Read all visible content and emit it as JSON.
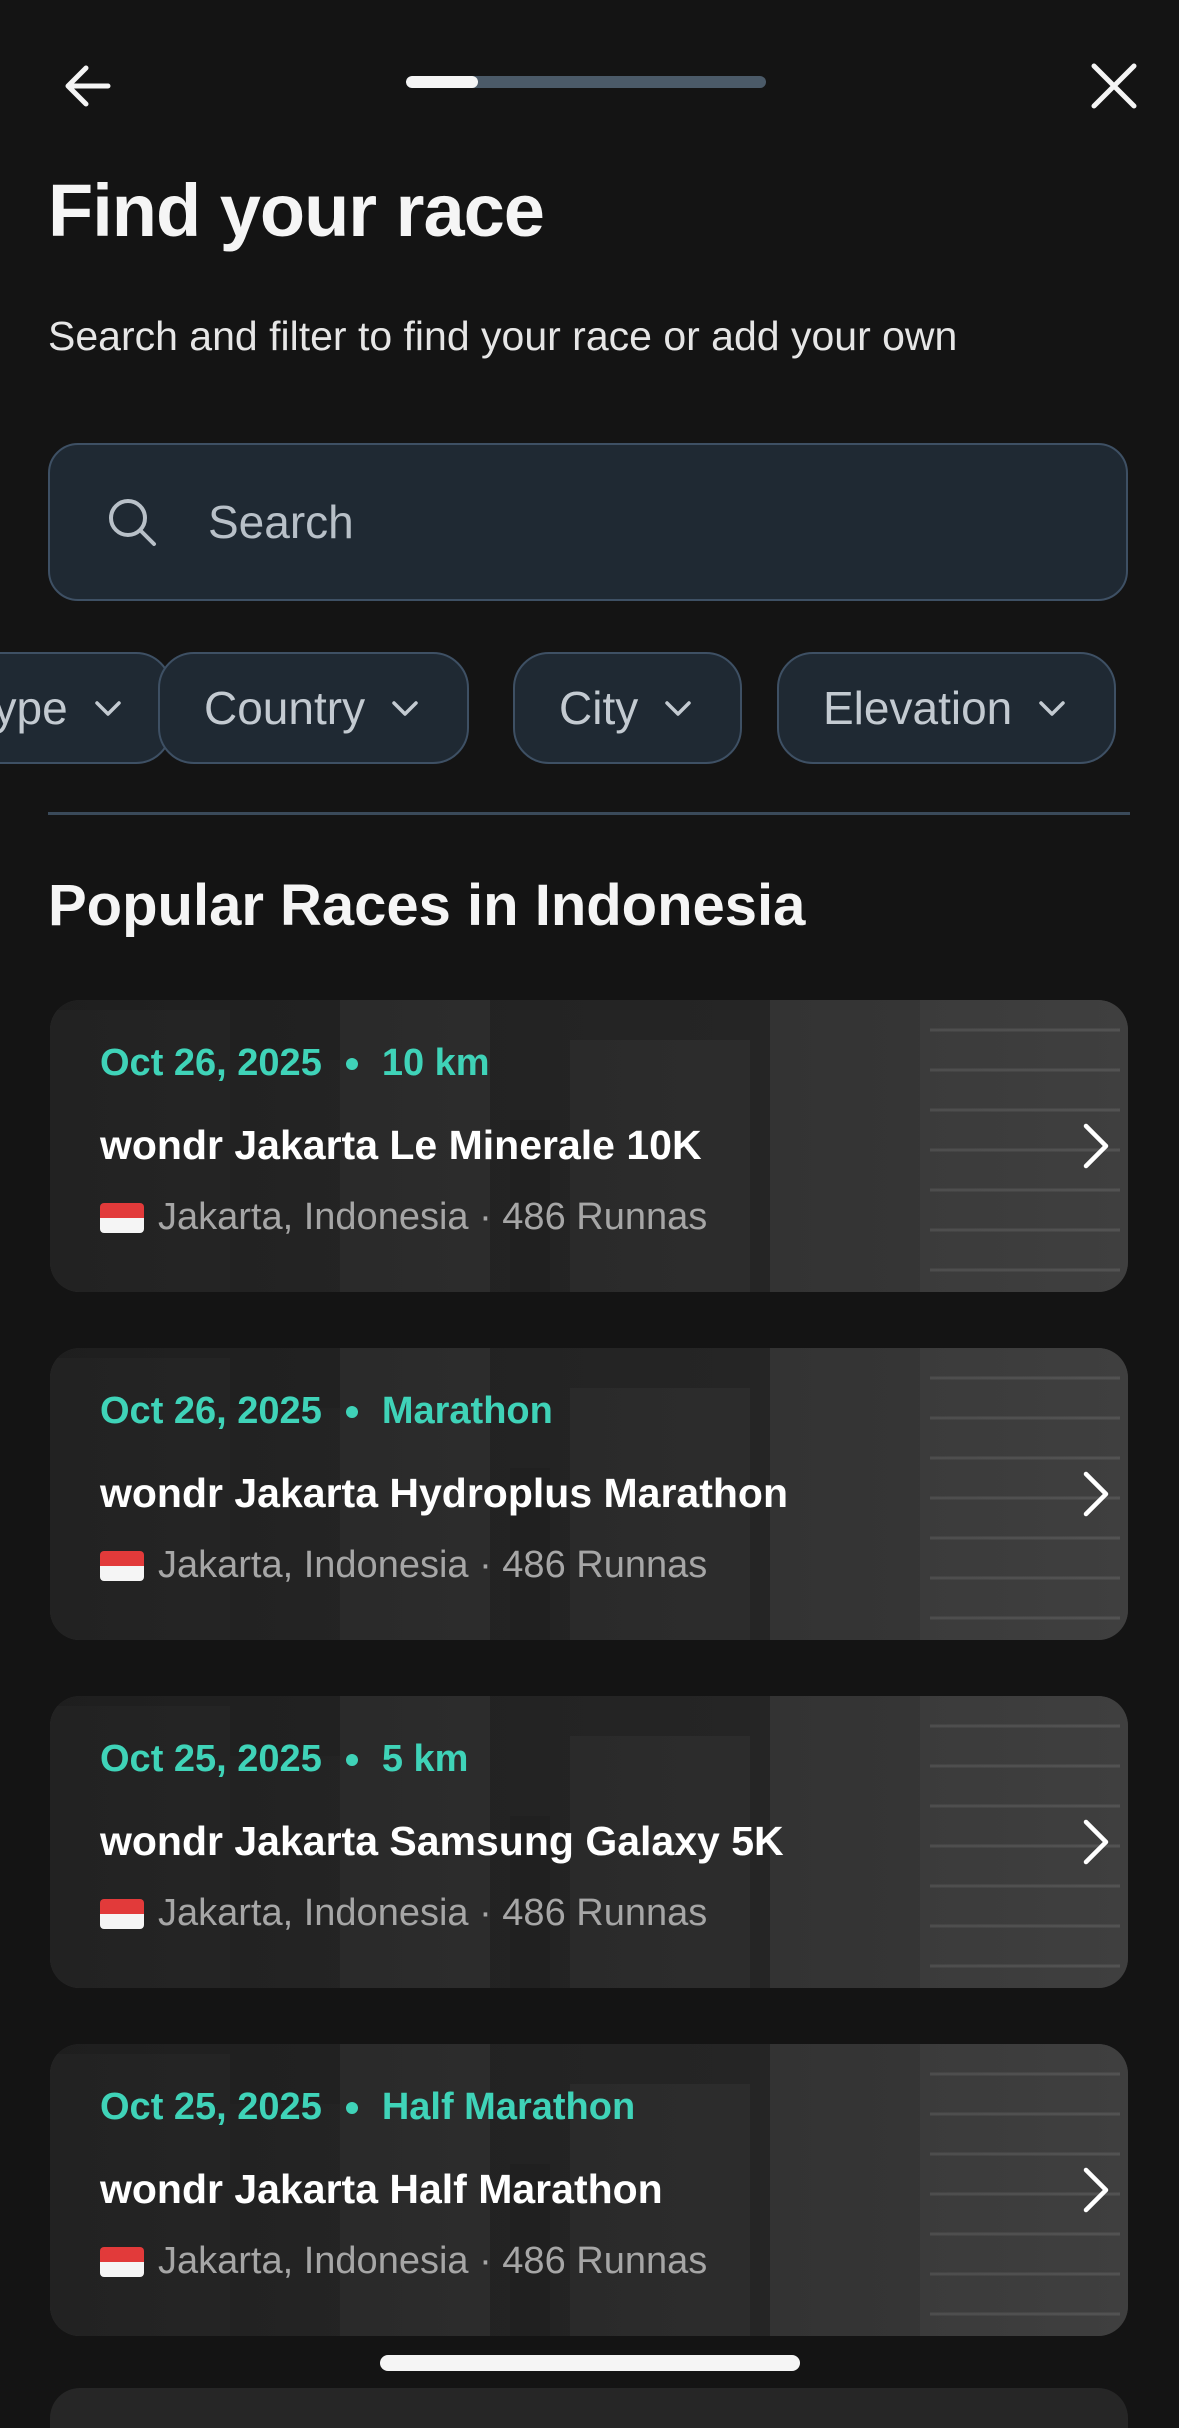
{
  "header": {
    "back_icon": "arrow-left-icon",
    "close_icon": "close-icon",
    "progress": 0.2
  },
  "page": {
    "title": "Find your race",
    "subtitle": "Search and filter to find your race or add your own"
  },
  "search": {
    "placeholder": "Search",
    "value": "",
    "icon": "search-icon"
  },
  "filters": [
    {
      "label": "Type"
    },
    {
      "label": "Country"
    },
    {
      "label": "City"
    },
    {
      "label": "Elevation"
    }
  ],
  "section": {
    "title": "Popular Races in Indonesia"
  },
  "races": [
    {
      "date": "Oct 26, 2025",
      "distance": "10 km",
      "name": "wondr Jakarta Le Minerale 10K",
      "location": "Jakarta, Indonesia · 486 Runnas"
    },
    {
      "date": "Oct 26, 2025",
      "distance": "Marathon",
      "name": "wondr Jakarta Hydroplus Marathon",
      "location": "Jakarta, Indonesia · 486 Runnas"
    },
    {
      "date": "Oct 25, 2025",
      "distance": "5 km",
      "name": "wondr Jakarta Samsung Galaxy 5K",
      "location": "Jakarta, Indonesia · 486 Runnas"
    },
    {
      "date": "Oct 25, 2025",
      "distance": "Half Marathon",
      "name": "wondr Jakarta Half Marathon",
      "location": "Jakarta, Indonesia · 486 Runnas"
    }
  ],
  "colors": {
    "background": "#141414",
    "accent": "#3fd3b8",
    "field": "#1f2933",
    "border": "#3e5064"
  }
}
